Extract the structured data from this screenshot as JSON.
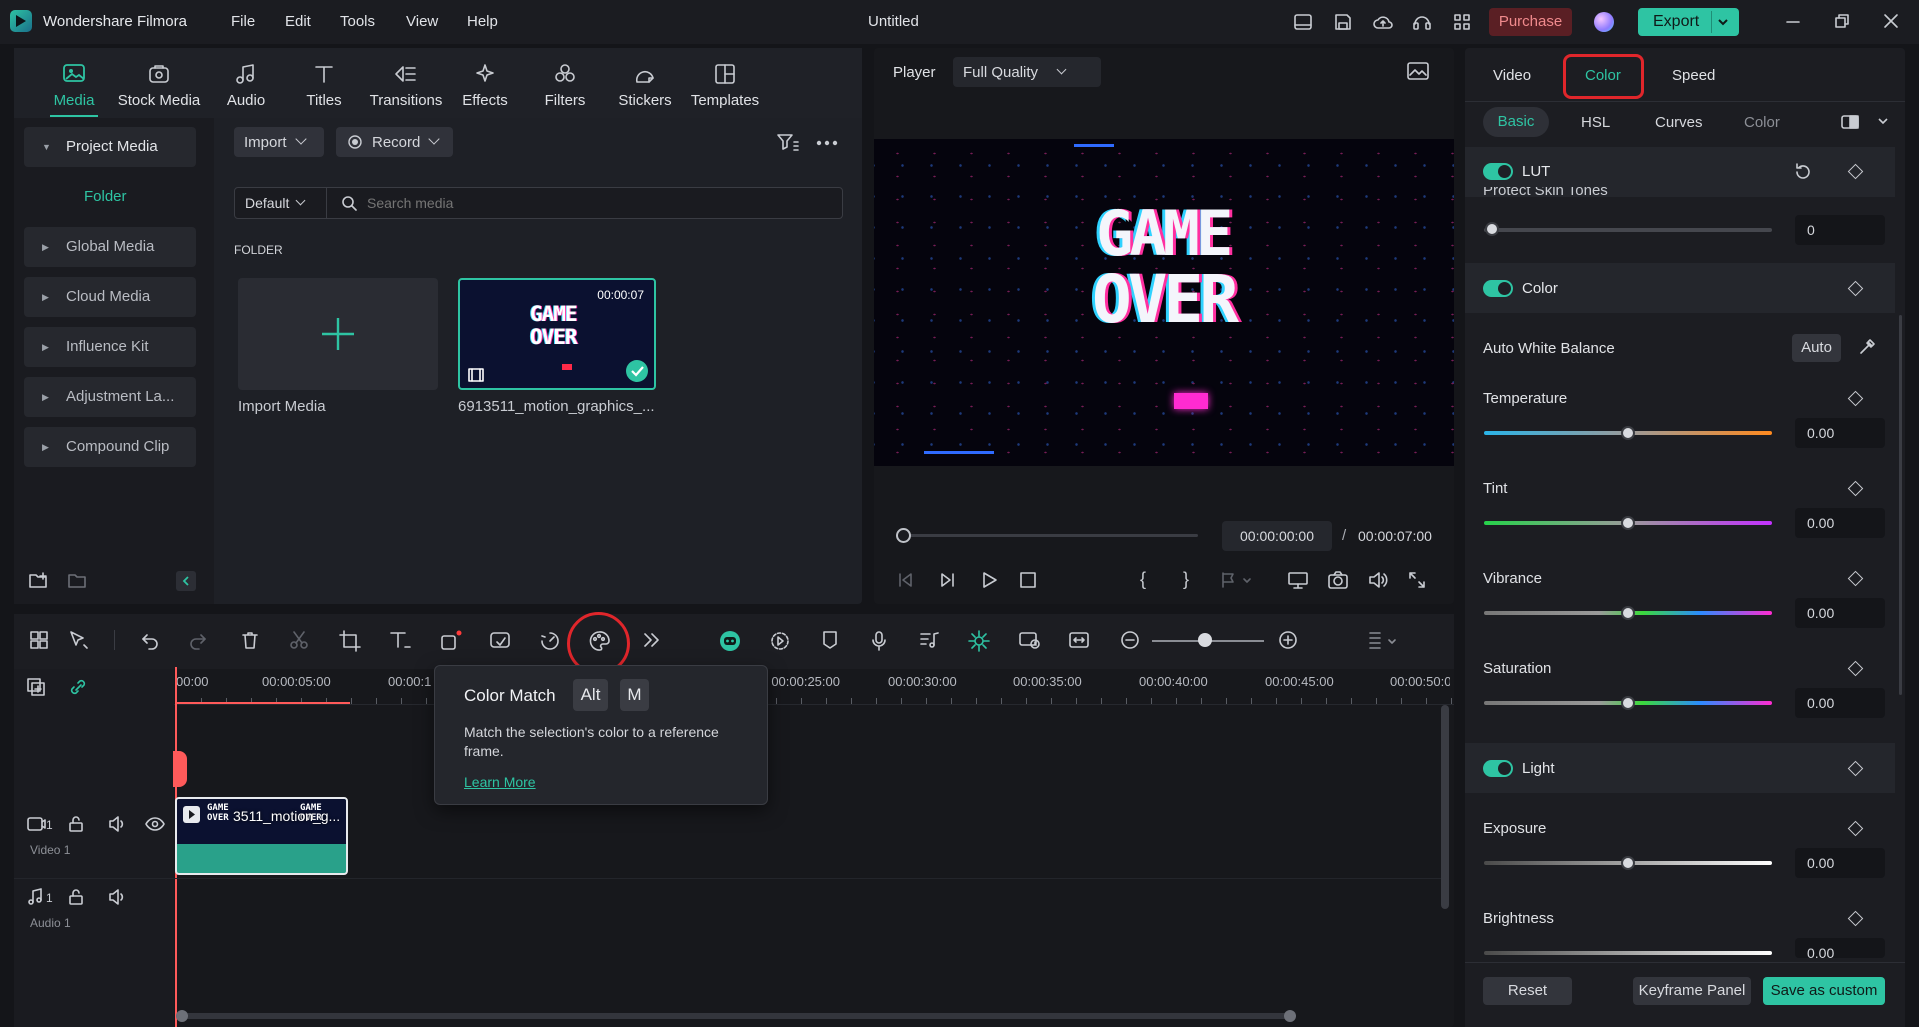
{
  "app": {
    "name": "Wondershare Filmora",
    "title": "Untitled"
  },
  "menu": [
    "File",
    "Edit",
    "Tools",
    "View",
    "Help"
  ],
  "titlebar": {
    "purchase": "Purchase",
    "export": "Export"
  },
  "toolbar": {
    "tabs": [
      {
        "label": "Media",
        "icon": "media-icon",
        "active": true
      },
      {
        "label": "Stock Media",
        "icon": "stock-media-icon"
      },
      {
        "label": "Audio",
        "icon": "audio-note-icon"
      },
      {
        "label": "Titles",
        "icon": "titles-t-icon"
      },
      {
        "label": "Transitions",
        "icon": "transitions-icon"
      },
      {
        "label": "Effects",
        "icon": "effects-sparkle-icon"
      },
      {
        "label": "Filters",
        "icon": "filters-circles-icon"
      },
      {
        "label": "Stickers",
        "icon": "stickers-icon"
      },
      {
        "label": "Templates",
        "icon": "templates-grid-icon"
      }
    ]
  },
  "sidebar": {
    "project_media": "Project Media",
    "folder": "Folder",
    "items": [
      "Global Media",
      "Cloud Media",
      "Influence Kit",
      "Adjustment La...",
      "Compound Clip"
    ]
  },
  "media": {
    "import": "Import",
    "record": "Record",
    "sort": "Default",
    "search_placeholder": "Search media",
    "folder_heading": "FOLDER",
    "import_media_label": "Import Media",
    "clip_name": "6913511_motion_graphics_...",
    "clip_duration": "00:00:07",
    "thumb_text": [
      "GAME",
      "OVER"
    ]
  },
  "player": {
    "label": "Player",
    "quality": "Full Quality",
    "current_time": "00:00:00:00",
    "separator": "/",
    "total_time": "00:00:07:00",
    "preview_text": [
      "GAME",
      "OVER"
    ]
  },
  "inspector": {
    "tabs": [
      "Video",
      "Color",
      "Speed"
    ],
    "active_tab": "Color",
    "subtabs": [
      "Basic",
      "HSL",
      "Curves",
      "Color"
    ],
    "active_subtab": "Basic",
    "lut": {
      "label": "LUT",
      "partial_label": "Protect Skin Tones",
      "value": "0"
    },
    "color_section": "Color",
    "auto_white_balance": "Auto White Balance",
    "auto_button": "Auto",
    "temperature": {
      "label": "Temperature",
      "value": "0.00"
    },
    "tint": {
      "label": "Tint",
      "value": "0.00"
    },
    "vibrance": {
      "label": "Vibrance",
      "value": "0.00"
    },
    "saturation": {
      "label": "Saturation",
      "value": "0.00"
    },
    "light_section": "Light",
    "exposure": {
      "label": "Exposure",
      "value": "0.00"
    },
    "brightness": {
      "label": "Brightness",
      "value": "0.00"
    },
    "footer": {
      "reset": "Reset",
      "keyframe": "Keyframe Panel",
      "save": "Save as custom"
    }
  },
  "timeline": {
    "ruler": [
      "00:00",
      "00:00:05:00",
      "00:00:1",
      "00:00:25:00",
      "00:00:30:00",
      "00:00:35:00",
      "00:00:40:00",
      "00:00:45:00",
      "00:00:50:0"
    ],
    "video_track": "Video 1",
    "audio_track": "Audio 1",
    "track_num": "1",
    "clip_label": "3511_motion_g...",
    "clip_thumb_text": [
      "GAME",
      "OVER"
    ]
  },
  "tooltip": {
    "title": "Color Match",
    "key1": "Alt",
    "key2": "M",
    "body": "Match the selection's color to a reference frame.",
    "link": "Learn More"
  },
  "colors": {
    "accent": "#2ec4a3",
    "purchase": "#5a1f24",
    "highlight_ring": "#e0262b",
    "playhead": "#ff5a5a"
  }
}
